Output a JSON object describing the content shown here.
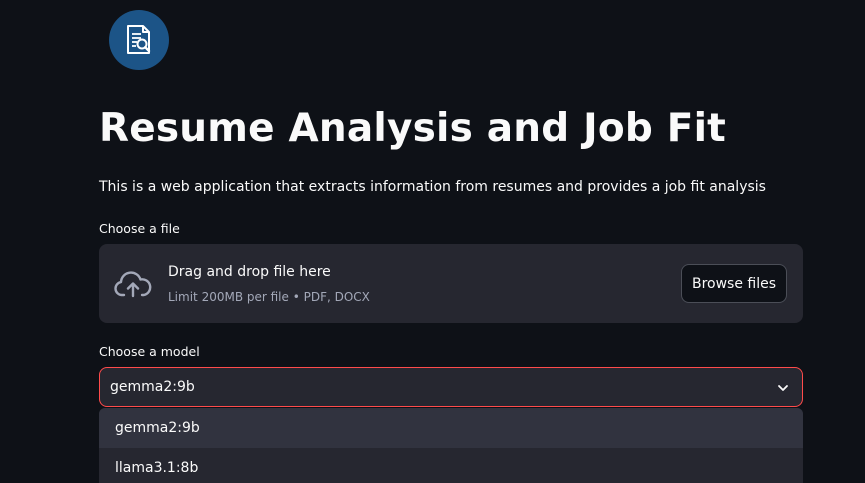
{
  "header": {
    "logo_icon": "resume-search-icon",
    "title": "Resume Analysis and Job Fit",
    "description": "This is a web application that extracts information from resumes and provides a job fit analysis"
  },
  "file_uploader": {
    "label": "Choose a file",
    "icon": "cloud-upload-icon",
    "title": "Drag and drop file here",
    "subtitle": "Limit 200MB per file • PDF, DOCX",
    "browse_label": "Browse files"
  },
  "model_select": {
    "label": "Choose a model",
    "value": "gemma2:9b",
    "options": [
      "gemma2:9b",
      "llama3.1:8b"
    ],
    "focus_color": "#ff4b4b"
  },
  "colors": {
    "background": "#0e1117",
    "widget": "#262730",
    "logo": "#1c5487",
    "text": "#fafafa",
    "muted": "#a3a8b8"
  }
}
